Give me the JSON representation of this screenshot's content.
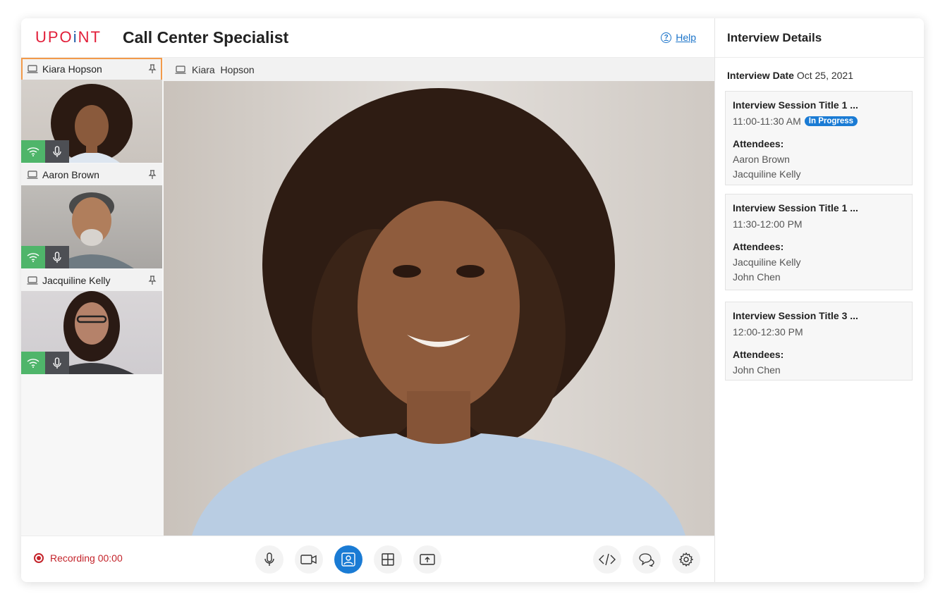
{
  "header": {
    "logo_left": "UPO",
    "logo_mid": "i",
    "logo_right": "NT",
    "title": "Call Center Specialist",
    "help_label": "Help"
  },
  "participants": [
    {
      "name": "Kiara Hopson",
      "active": true
    },
    {
      "name": "Aaron Brown",
      "active": false
    },
    {
      "name": "Jacquiline Kelly",
      "active": false
    }
  ],
  "stage": {
    "speaker": "Kiara  Hopson"
  },
  "footer": {
    "recording_label": "Recording 00:00",
    "controls": [
      "microphone",
      "camera",
      "presenter-view",
      "grid-layout",
      "share-screen"
    ],
    "right_controls": [
      "embed-code",
      "chat",
      "settings"
    ]
  },
  "details": {
    "heading": "Interview Details",
    "date_label": "Interview Date",
    "date_value": "Oct 25, 2021",
    "attendees_label": "Attendees:",
    "sessions": [
      {
        "title": "Interview Session Title 1 ...",
        "time": "11:00-11:30 AM",
        "status": "In Progress",
        "attendees": [
          "Aaron Brown",
          "Jacquiline Kelly"
        ]
      },
      {
        "title": "Interview Session Title 1 ...",
        "time": "11:30-12:00 PM",
        "status": "",
        "attendees": [
          "Jacquiline Kelly",
          "John Chen"
        ]
      },
      {
        "title": "Interview Session Title 3 ...",
        "time": "12:00-12:30 PM",
        "status": "",
        "attendees": [
          "John Chen"
        ]
      }
    ]
  },
  "colors": {
    "accent": "#1a7bd4",
    "record": "#c4242b",
    "active_border": "#f29a4a",
    "signal": "#4fb56a"
  }
}
